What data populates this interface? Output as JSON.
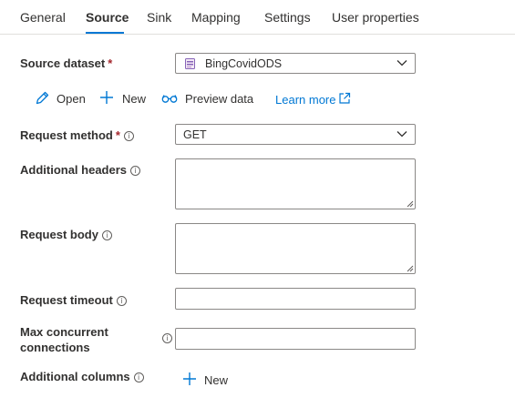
{
  "tabs": [
    {
      "label": "General"
    },
    {
      "label": "Source"
    },
    {
      "label": "Sink"
    },
    {
      "label": "Mapping"
    },
    {
      "label": "Settings"
    },
    {
      "label": "User properties"
    }
  ],
  "source_dataset": {
    "label": "Source dataset",
    "required_mark": "*",
    "value": "BingCovidODS"
  },
  "actions": {
    "open": "Open",
    "new": "New",
    "preview": "Preview data",
    "learn_more": "Learn more"
  },
  "request_method": {
    "label": "Request method",
    "required_mark": "*",
    "value": "GET"
  },
  "additional_headers": {
    "label": "Additional headers",
    "value": ""
  },
  "request_body": {
    "label": "Request body",
    "value": ""
  },
  "request_timeout": {
    "label": "Request timeout",
    "value": ""
  },
  "max_concurrent": {
    "label_line1": "Max concurrent",
    "label_line2": "connections",
    "value": ""
  },
  "additional_columns": {
    "label": "Additional columns",
    "new_label": "New"
  },
  "colors": {
    "accent": "#0078d4",
    "required": "#a4262c",
    "border": "#8a8886"
  }
}
